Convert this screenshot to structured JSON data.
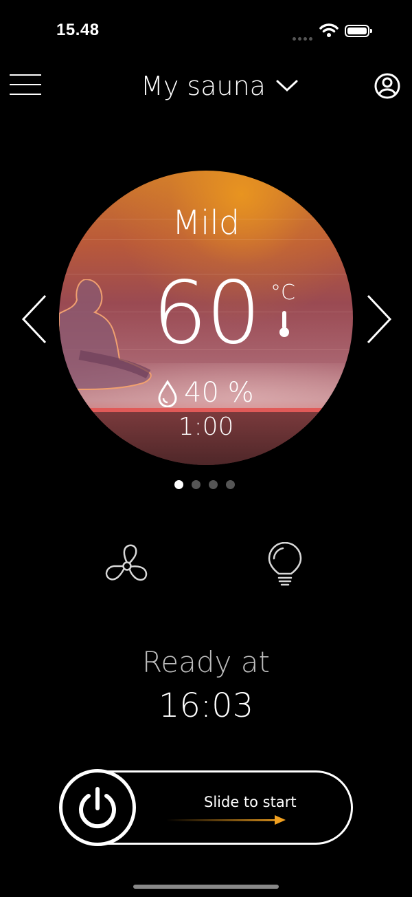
{
  "status_bar": {
    "time": "15.48"
  },
  "header": {
    "title": "My sauna"
  },
  "program": {
    "mode": "Mild",
    "temperature": "60",
    "unit": "°C",
    "humidity": "40 %",
    "duration": "1:00"
  },
  "pager": {
    "total": 4,
    "active": 0
  },
  "status": {
    "ready_label": "Ready at",
    "ready_time": "16:03"
  },
  "slider": {
    "label": "Slide to start"
  },
  "colors": {
    "accent": "#f0a020",
    "background": "#000000"
  },
  "icons": [
    "menu-icon",
    "chevron-down-icon",
    "profile-icon",
    "chevron-left-icon",
    "chevron-right-icon",
    "thermometer-icon",
    "droplet-icon",
    "fan-icon",
    "lightbulb-icon",
    "power-icon",
    "arrow-right-icon"
  ]
}
